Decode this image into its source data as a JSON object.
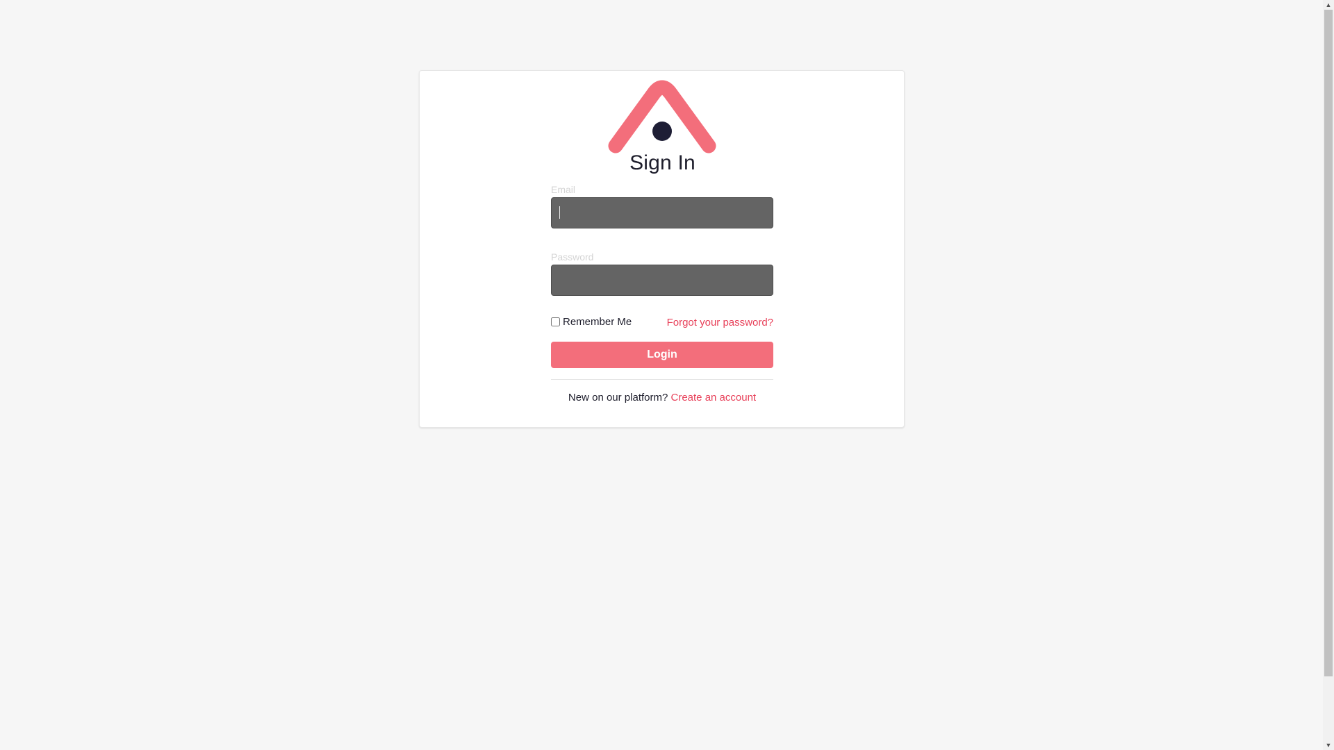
{
  "page": {
    "title": "Sign In"
  },
  "logo": {
    "name": "brand-house-logo",
    "stroke_color": "#f36e7b",
    "dot_color": "#1e1e35"
  },
  "form": {
    "email_label": "Email",
    "email_value": "",
    "password_label": "Password",
    "password_value": "",
    "remember_label": "Remember Me",
    "remember_checked": false,
    "forgot_label": "Forgot your password?",
    "login_label": "Login",
    "signup_prompt": "New on our platform?",
    "signup_link": "Create an account"
  },
  "colors": {
    "accent": "#f36e7b",
    "link": "#e8415a",
    "input_bg": "#646464",
    "page_bg": "#f6f6f6"
  },
  "scrollbar": {
    "up_icon": "▲",
    "down_icon": "▼"
  }
}
